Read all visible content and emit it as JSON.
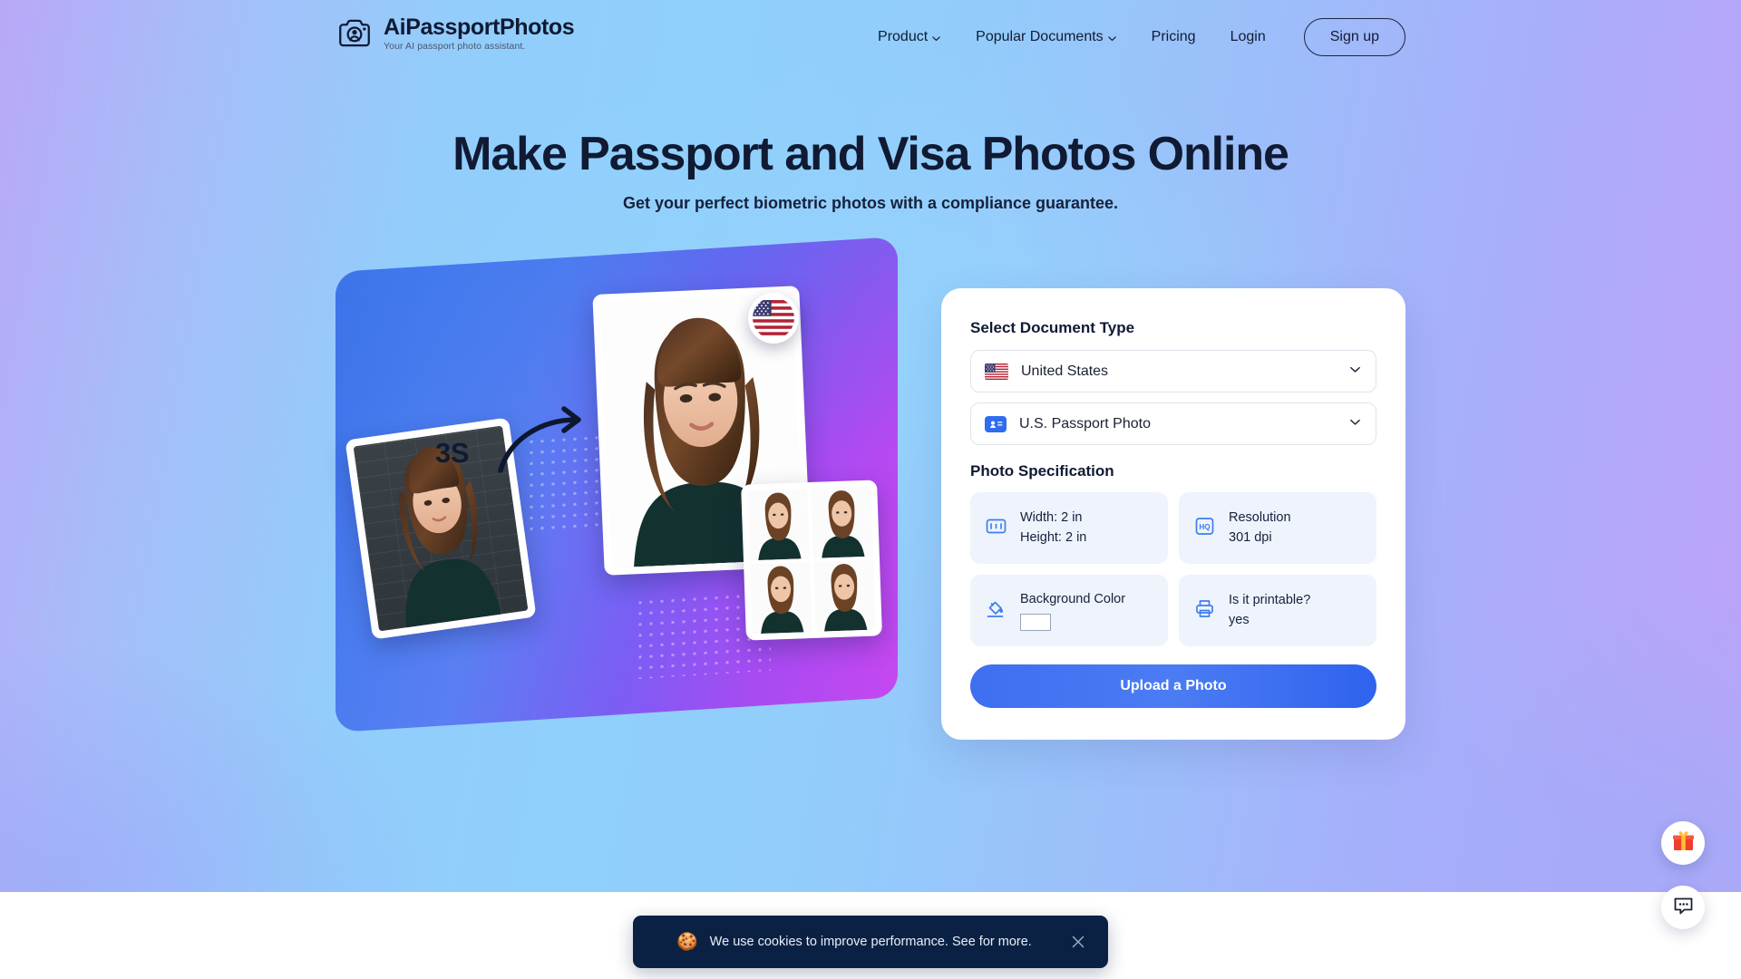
{
  "brand": {
    "name": "AiPassportPhotos",
    "tagline": "Your AI passport photo assistant.",
    "logo_icon": "camera-portrait-icon"
  },
  "nav": {
    "items": [
      {
        "label": "Product",
        "has_dropdown": true,
        "icon": "chevron-down-icon"
      },
      {
        "label": "Popular Documents",
        "has_dropdown": true,
        "icon": "chevron-down-icon"
      },
      {
        "label": "Pricing",
        "has_dropdown": false
      },
      {
        "label": "Login",
        "has_dropdown": false
      }
    ],
    "signup_label": "Sign up"
  },
  "hero": {
    "headline": "Make Passport and Visa Photos Online",
    "subheadline": "Get your perfect biometric photos with a compliance guarantee.",
    "illustration": {
      "speed_label": "3S",
      "arrow_icon": "curved-arrow-icon",
      "flag_badge_icon": "us-flag-badge-icon",
      "original_photo_alt": "original portrait photo on dark brick background",
      "result_photo_alt": "processed passport portrait on white background",
      "sheet_photo_alt": "printable sheet of four passport photos"
    }
  },
  "form": {
    "document_type_heading": "Select Document Type",
    "country_select": {
      "value": "United States",
      "icon": "us-flag-icon",
      "chevron": "chevron-down-icon"
    },
    "document_select": {
      "value": "U.S. Passport Photo",
      "icon": "id-badge-icon",
      "chevron": "chevron-down-icon"
    },
    "spec_heading": "Photo Specification",
    "specs": [
      {
        "icon": "aspect-ratio-icon",
        "line1": "Width: 2 in",
        "line2": "Height: 2 in",
        "type": "text"
      },
      {
        "icon": "hq-resolution-icon",
        "line1": "Resolution",
        "line2": "301 dpi",
        "type": "text"
      },
      {
        "icon": "paint-bucket-icon",
        "line1": "Background Color",
        "line2": "",
        "type": "swatch",
        "swatch_color": "#ffffff"
      },
      {
        "icon": "printer-icon",
        "line1": "Is it printable?",
        "line2": "yes",
        "type": "text"
      }
    ],
    "upload_label": "Upload a Photo"
  },
  "floating": {
    "gift_icon": "gift-icon",
    "chat_icon": "chat-bubble-icon"
  },
  "cookie": {
    "icon": "cookie-icon",
    "message": "We use cookies to improve performance. See for more.",
    "close_icon": "close-icon"
  },
  "colors": {
    "accent_blue": "#3d6ff0",
    "dark_navy": "#101a33",
    "banner_bg": "#0b2144",
    "spec_card_bg": "#eef3fc"
  }
}
